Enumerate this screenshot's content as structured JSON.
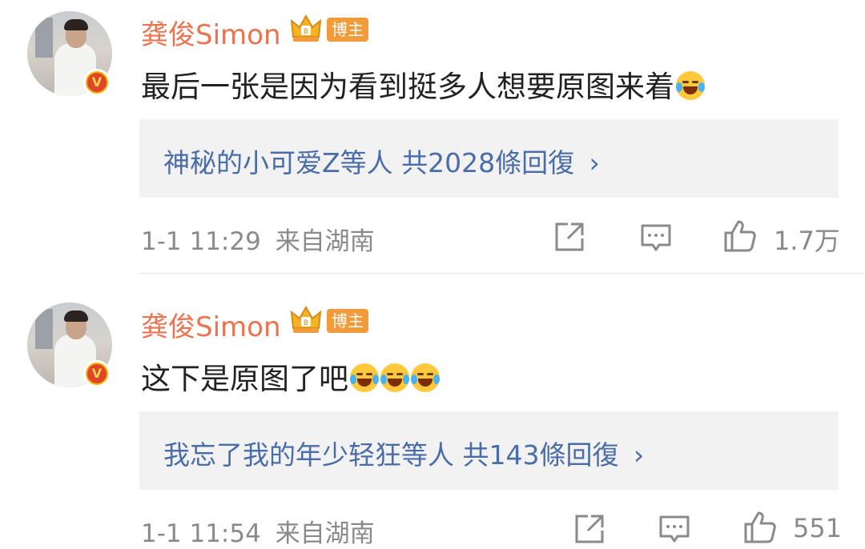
{
  "comments": [
    {
      "username": "龚俊Simon",
      "tag": "博主",
      "text": "最后一张是因为看到挺多人想要原图来着",
      "emoji_count": 1,
      "reply_users": "神秘的小可爱Z等人",
      "reply_count": "共2028條回復",
      "reply_arrow": "›",
      "time": "1-1 11:29",
      "location": "来自湖南",
      "likes": "1.7万"
    },
    {
      "username": "龚俊Simon",
      "tag": "博主",
      "text": "这下是原图了吧",
      "emoji_count": 3,
      "reply_users": "我忘了我的年少轻狂等人",
      "reply_count": "共143條回復",
      "reply_arrow": "›",
      "time": "1-1 11:54",
      "location": "来自湖南",
      "likes": "551"
    }
  ],
  "icons": [
    "verified-v-icon",
    "crown-badge-icon",
    "laugh-cry-emoji-icon",
    "share-icon",
    "comment-icon",
    "like-icon"
  ],
  "colors": {
    "username": "#eb7350",
    "reply_link": "#4a6da7",
    "meta": "#8a8a8a",
    "reply_bg": "#f2f2f2",
    "tag_bg": "#f29b3b"
  }
}
